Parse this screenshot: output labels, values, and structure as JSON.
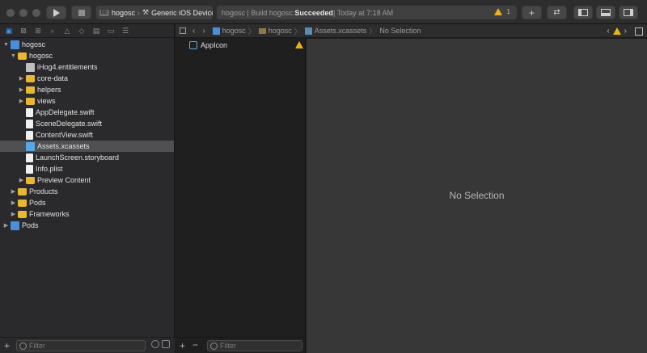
{
  "toolbar": {
    "scheme": {
      "badge": "BE",
      "project": "hogosc",
      "device": "Generic iOS Device"
    },
    "activity": {
      "prefix": "hogosc | Build hogosc: ",
      "status": "Succeeded",
      "suffix": " | Today at 7:18 AM",
      "warning_count": "1"
    }
  },
  "navigator": {
    "tree": [
      {
        "label": "hogosc",
        "indent": 0,
        "expanded": true,
        "icon": "project-icon"
      },
      {
        "label": "hogosc",
        "indent": 1,
        "expanded": true,
        "icon": "folder-icon"
      },
      {
        "label": "iHog4.entitlements",
        "indent": 2,
        "icon": "entitlements-icon"
      },
      {
        "label": "core-data",
        "indent": 2,
        "expanded": false,
        "icon": "folder-icon"
      },
      {
        "label": "helpers",
        "indent": 2,
        "expanded": false,
        "icon": "folder-icon"
      },
      {
        "label": "views",
        "indent": 2,
        "expanded": false,
        "icon": "folder-icon"
      },
      {
        "label": "AppDelegate.swift",
        "indent": 2,
        "icon": "swift-file-icon"
      },
      {
        "label": "SceneDelegate.swift",
        "indent": 2,
        "icon": "swift-file-icon"
      },
      {
        "label": "ContentView.swift",
        "indent": 2,
        "icon": "swift-file-icon"
      },
      {
        "label": "Assets.xcassets",
        "indent": 2,
        "icon": "assets-icon",
        "selected": true
      },
      {
        "label": "LaunchScreen.storyboard",
        "indent": 2,
        "icon": "storyboard-icon"
      },
      {
        "label": "Info.plist",
        "indent": 2,
        "icon": "plist-icon"
      },
      {
        "label": "Preview Content",
        "indent": 2,
        "expanded": false,
        "icon": "folder-icon"
      },
      {
        "label": "Products",
        "indent": 1,
        "expanded": false,
        "icon": "folder-icon"
      },
      {
        "label": "Pods",
        "indent": 1,
        "expanded": false,
        "icon": "folder-icon"
      },
      {
        "label": "Frameworks",
        "indent": 1,
        "expanded": false,
        "icon": "folder-icon"
      },
      {
        "label": "Pods",
        "indent": 0,
        "expanded": false,
        "icon": "project-icon"
      }
    ],
    "filter_placeholder": "Filter"
  },
  "jumpbar": {
    "crumbs": [
      "hogosc",
      "hogosc",
      "Assets.xcassets",
      "No Selection"
    ]
  },
  "assets": {
    "items": [
      {
        "label": "AppIcon",
        "warning": true
      }
    ],
    "filter_placeholder": "Filter"
  },
  "detail": {
    "empty_label": "No Selection"
  },
  "colors": {
    "accent": "#3d8ef0",
    "warning": "#e8b220",
    "folder": "#e8b735",
    "selection": "#4f5052"
  }
}
